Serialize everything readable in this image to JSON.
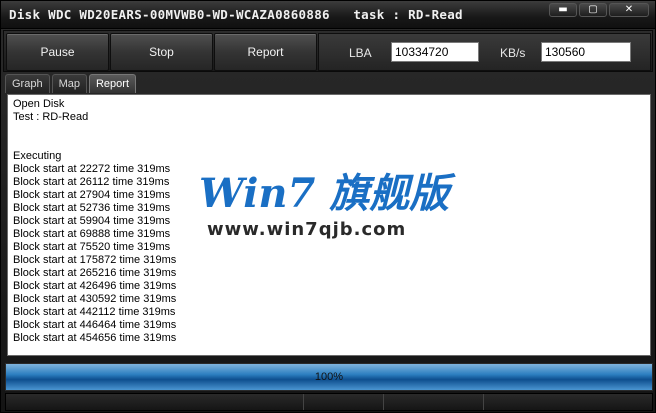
{
  "window": {
    "title": "Disk WDC WD20EARS-00MVWB0-WD-WCAZA0860886   task : RD-Read",
    "controls": {
      "minimize": "▬",
      "maximize": "▢",
      "close": "✕"
    }
  },
  "toolbar": {
    "pause_label": "Pause",
    "stop_label": "Stop",
    "report_label": "Report",
    "lba_label": "LBA",
    "lba_value": "10334720",
    "kbs_label": "KB/s",
    "kbs_value": "130560"
  },
  "tabs": [
    {
      "label": "Graph",
      "active": false
    },
    {
      "label": "Map",
      "active": false
    },
    {
      "label": "Report",
      "active": true
    }
  ],
  "log": {
    "lines": [
      "Open Disk",
      "Test : RD-Read",
      "",
      "",
      "Executing",
      "Block start at 22272 time 319ms",
      "Block start at 26112 time 319ms",
      "Block start at 27904 time 319ms",
      "Block start at 52736 time 319ms",
      "Block start at 59904 time 319ms",
      "Block start at 69888 time 319ms",
      "Block start at 75520 time 319ms",
      "Block start at 175872 time 319ms",
      "Block start at 265216 time 319ms",
      "Block start at 426496 time 319ms",
      "Block start at 430592 time 319ms",
      "Block start at 442112 time 319ms",
      "Block start at 446464 time 319ms",
      "Block start at 454656 time 319ms"
    ]
  },
  "watermark": {
    "logo": "Win7 旗舰版",
    "url": "www.win7qjb.com"
  },
  "progress": {
    "value": 100,
    "label": "100%"
  },
  "colors": {
    "progress_accent": "#2d7fc0",
    "watermark_blue": "#1a6fc4"
  }
}
